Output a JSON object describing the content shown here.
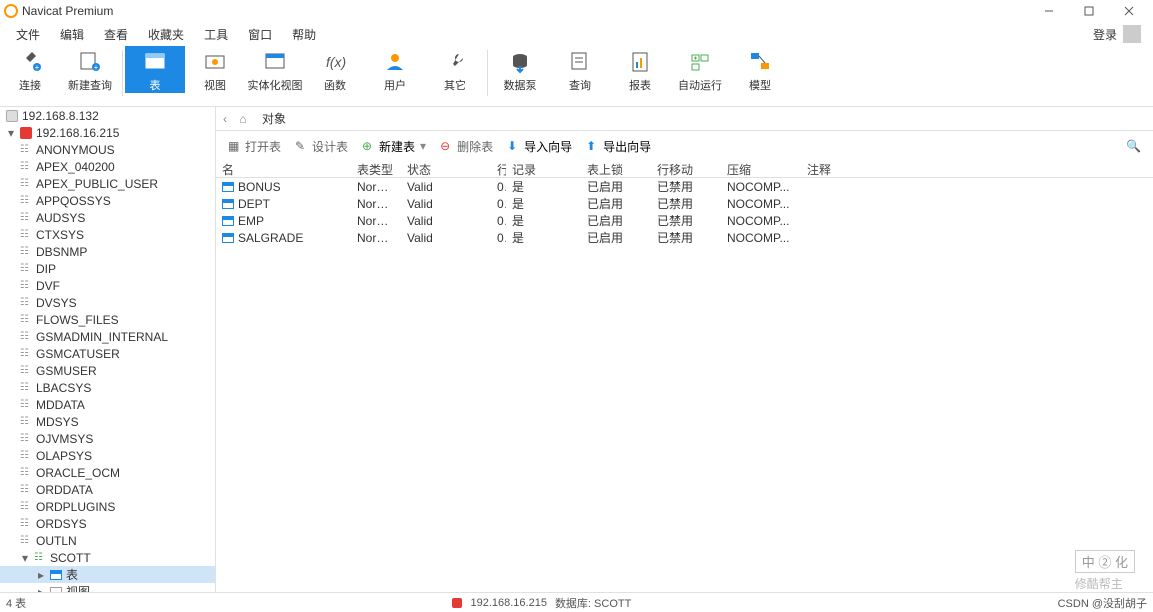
{
  "title": "Navicat Premium",
  "menus": [
    "文件",
    "编辑",
    "查看",
    "收藏夹",
    "工具",
    "窗口",
    "帮助"
  ],
  "login": "登录",
  "toolbar": {
    "connect": "连接",
    "newquery": "新建查询",
    "table": "表",
    "view": "视图",
    "matview": "实体化视图",
    "function": "函数",
    "user": "用户",
    "other": "其它",
    "datapump": "数据泵",
    "query": "查询",
    "report": "报表",
    "autorun": "自动运行",
    "model": "模型"
  },
  "tree": {
    "conn_gray": "192.168.8.132",
    "conn_red": "192.168.16.215",
    "schemas": [
      "ANONYMOUS",
      "APEX_040200",
      "APEX_PUBLIC_USER",
      "APPQOSSYS",
      "AUDSYS",
      "CTXSYS",
      "DBSNMP",
      "DIP",
      "DVF",
      "DVSYS",
      "FLOWS_FILES",
      "GSMADMIN_INTERNAL",
      "GSMCATUSER",
      "GSMUSER",
      "LBACSYS",
      "MDDATA",
      "MDSYS",
      "OJVMSYS",
      "OLAPSYS",
      "ORACLE_OCM",
      "ORDDATA",
      "ORDPLUGINS",
      "ORDSYS",
      "OUTLN"
    ],
    "scott": "SCOTT",
    "scott_children": {
      "table": "表",
      "view": "视图"
    }
  },
  "tabs": {
    "object": "对象"
  },
  "ob": {
    "open": "打开表",
    "design": "设计表",
    "new": "新建表",
    "delete": "删除表",
    "importw": "导入向导",
    "exportw": "导出向导"
  },
  "columns": {
    "name": "名",
    "type": "表类型",
    "status": "状态",
    "rows": "行",
    "rec": "记录",
    "lock": "表上锁",
    "move": "行移动",
    "comp": "压缩",
    "note": "注释"
  },
  "rows": [
    {
      "name": "BONUS",
      "type": "Normal",
      "status": "Valid",
      "rows": "0",
      "rec": "是",
      "lock": "已启用",
      "move": "已禁用",
      "comp": "NOCOMP..."
    },
    {
      "name": "DEPT",
      "type": "Normal",
      "status": "Valid",
      "rows": "0",
      "rec": "是",
      "lock": "已启用",
      "move": "已禁用",
      "comp": "NOCOMP..."
    },
    {
      "name": "EMP",
      "type": "Normal",
      "status": "Valid",
      "rows": "0",
      "rec": "是",
      "lock": "已启用",
      "move": "已禁用",
      "comp": "NOCOMP..."
    },
    {
      "name": "SALGRADE",
      "type": "Normal",
      "status": "Valid",
      "rows": "0",
      "rec": "是",
      "lock": "已启用",
      "move": "已禁用",
      "comp": "NOCOMP..."
    }
  ],
  "status": {
    "count": "4 表",
    "conn": "192.168.16.215",
    "db": "数据库: SCOTT",
    "right": "CSDN @没刮胡子"
  },
  "watermark": {
    "top": "中 ② 化",
    "bottom": "修酷帮主"
  }
}
